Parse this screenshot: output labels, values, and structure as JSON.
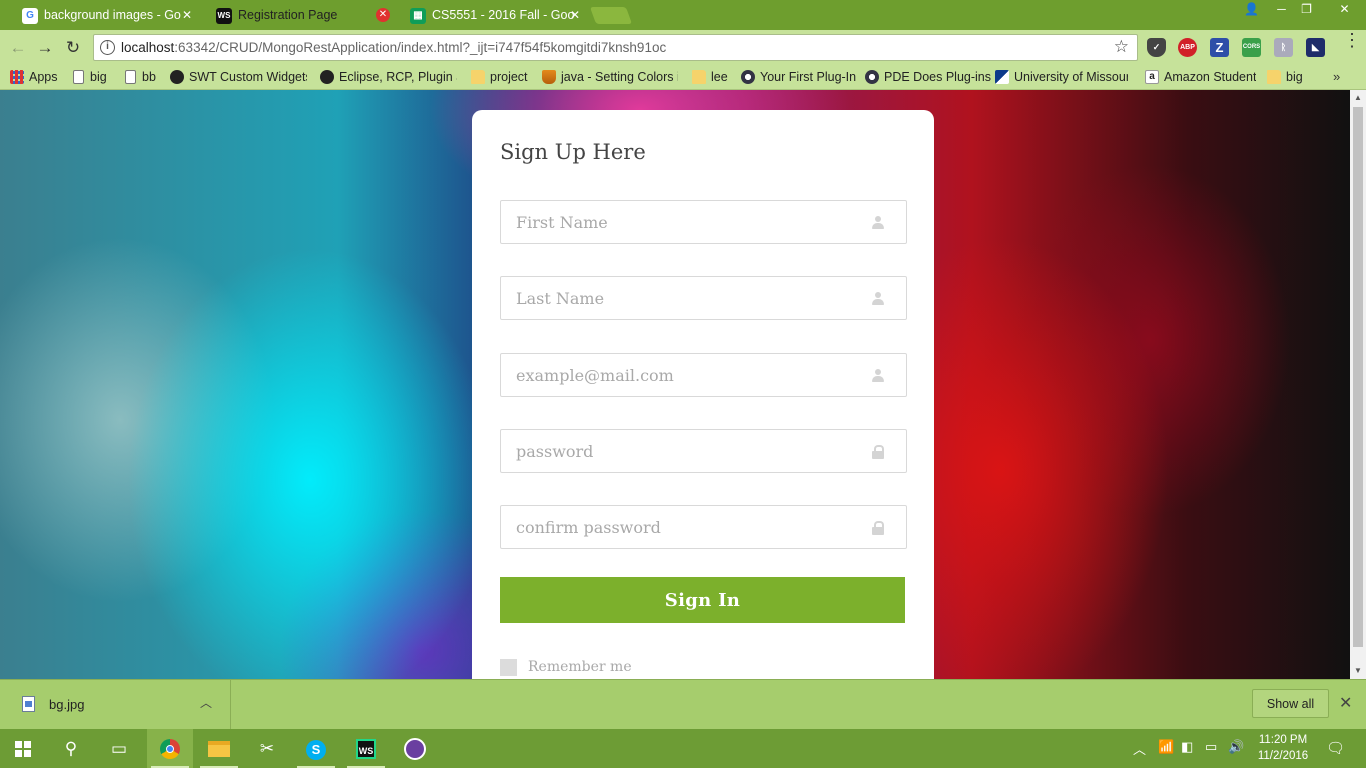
{
  "browser": {
    "tabs": [
      {
        "title": "background images - Go",
        "favicon": "google-g-icon",
        "active": false
      },
      {
        "title": "Registration Page",
        "favicon": "webstorm-icon",
        "active": true
      },
      {
        "title": "CS5551 - 2016 Fall - Goo",
        "favicon": "sheets-icon",
        "active": false
      }
    ],
    "url_host": "localhost",
    "url_rest": ":63342/CRUD/MongoRestApplication/index.html?_ijt=i747f54f5komgitdi7knsh91oc",
    "extensions": [
      "pocket-icon",
      "adblock-icon",
      "zotero-icon",
      "cors-icon",
      "extension-icon",
      "profile-icon"
    ],
    "extension_labels": {
      "adblock": "ABP",
      "zotero": "Z",
      "cors": "CORS"
    },
    "bookmarks": [
      {
        "label": "Apps",
        "icon": "apps"
      },
      {
        "label": "big",
        "icon": "page"
      },
      {
        "label": "bb",
        "icon": "page"
      },
      {
        "label": "SWT Custom Widgets",
        "icon": "dark"
      },
      {
        "label": "Eclipse, RCP, Plugin an",
        "icon": "dark"
      },
      {
        "label": "project",
        "icon": "folder"
      },
      {
        "label": "java - Setting Colors in",
        "icon": "java"
      },
      {
        "label": "lee",
        "icon": "folder"
      },
      {
        "label": "Your First Plug-In",
        "icon": "globe"
      },
      {
        "label": "PDE Does Plug-ins",
        "icon": "globe"
      },
      {
        "label": "University of Missouri",
        "icon": "um"
      },
      {
        "label": "Amazon Student",
        "icon": "amz"
      },
      {
        "label": "big",
        "icon": "folder"
      }
    ],
    "more_bookmarks": "»"
  },
  "form": {
    "title": "Sign Up Here",
    "fields": [
      {
        "placeholder": "First Name",
        "icon": "user-icon"
      },
      {
        "placeholder": "Last Name",
        "icon": "user-icon"
      },
      {
        "placeholder": "example@mail.com",
        "icon": "user-icon"
      },
      {
        "placeholder": "password",
        "icon": "lock-icon"
      },
      {
        "placeholder": "confirm password",
        "icon": "lock-icon"
      }
    ],
    "submit_label": "Sign In",
    "remember_label": "Remember me"
  },
  "downloads": {
    "file_name": "bg.jpg",
    "show_all_label": "Show all"
  },
  "taskbar": {
    "time": "11:20 PM",
    "date": "11/2/2016",
    "ws_label": "WS"
  },
  "colors": {
    "accent_green": "#7cb02c",
    "chrome_frame": "#6e9e2e",
    "active_tab": "#c6e29a"
  }
}
